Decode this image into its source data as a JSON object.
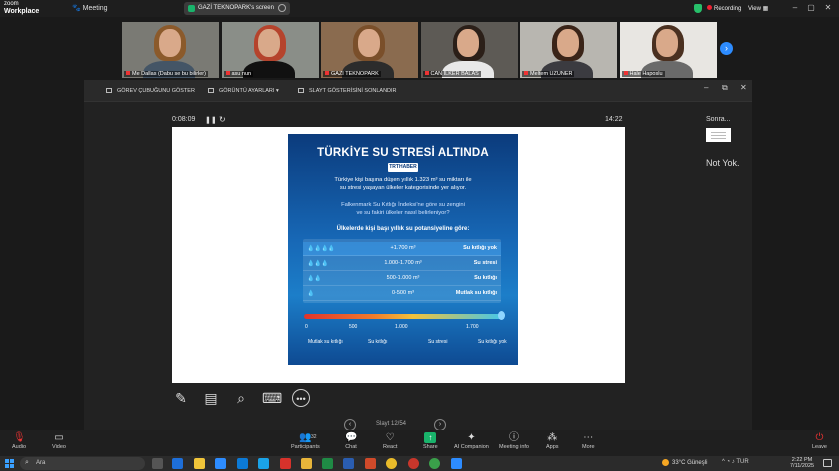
{
  "titlebar": {
    "app_name_line1": "zoom",
    "app_name_line2": "Workplace",
    "meeting_label": "Meeting",
    "tab_label": "GAZİ TEKNOPARK's screen",
    "recording_label": "Recording",
    "view_label": "View"
  },
  "gallery": {
    "participants": [
      {
        "name": "Me Dallas (Dabu se bu bilirler)",
        "hair": "#8b5a2b",
        "body": "#445566",
        "bg": "#7a7a74"
      },
      {
        "name": "asu nun",
        "hair": "#b5432c",
        "body": "#111111",
        "bg": "#8a8e88"
      },
      {
        "name": "GAZİ TEKNOPARK",
        "hair": "#7a4f2a",
        "body": "#2c2c2c",
        "bg": "#8a6b4f"
      },
      {
        "name": "CAN İLKER BALAS",
        "hair": "#2b1f18",
        "body": "#e8e8e8",
        "bg": "#5d5a55"
      },
      {
        "name": "Meltem UZUNER",
        "hair": "#3a2418",
        "body": "#3b3b40",
        "bg": "#b8b6b0"
      },
      {
        "name": "Hale Haposlu",
        "hair": "#4a3020",
        "body": "#6a6a6a",
        "bg": "#e8e6e2"
      }
    ],
    "next_icon": "chevron-right-icon"
  },
  "sharebar": {
    "taskbar_toggle": "GÖREV ÇUBUĞUNU GÖSTER",
    "display_settings": "GÖRÜNTÜ AYARLARI ▾",
    "end_slideshow": "SLAYT GÖSTERİSİNİ SONLANDIR"
  },
  "presenter": {
    "elapsed": "0:08:09",
    "clock": "14:22",
    "next_label": "Sonra...",
    "next_note": "Not Yok."
  },
  "infographic": {
    "title": "TÜRKİYE SU STRESİ ALTINDA",
    "brand": "TRTHABER",
    "p1_line1": "Türkiye kişi başına düşen yıllık 1.323 m³ su miktarı ile",
    "p1_line2": "su stresi yaşayan ülkeler kategorisinde yer alıyor.",
    "p2_line1": "Falkenmark Su Kıtlığı İndeksi'ne göre su zengini",
    "p2_line2": "ve su fakiri ülkeler nasıl belirleniyor?",
    "p3": "Ülkelerde kişi başı yıllık su potansiyeline göre:",
    "rows": [
      {
        "drops": "💧💧💧💧",
        "range": "+1.700 m³",
        "label": "Su kıtlığı yok"
      },
      {
        "drops": "💧💧💧",
        "range": "1.000-1.700 m³",
        "label": "Su stresi"
      },
      {
        "drops": "💧💧",
        "range": "500-1.000 m³",
        "label": "Su kıtlığı"
      },
      {
        "drops": "💧",
        "range": "0-500 m³",
        "label": "Mutlak su kıtlığı"
      }
    ],
    "ticks": [
      "0",
      "500",
      "1.000",
      "1.700"
    ],
    "categories": [
      "Mutlak su kıtlığı",
      "Su kıtlığı",
      "Su stresi",
      "Su kıtlığı yok"
    ]
  },
  "slide_tools": [
    "pen-icon",
    "slides-grid-icon",
    "zoom-icon",
    "screen-icon",
    "more-icon"
  ],
  "pager": {
    "text": "Slayt 12/54"
  },
  "zoombar": {
    "audio": "Audio",
    "video": "Video",
    "participants": "Participants",
    "participants_count": "32",
    "chat": "Chat",
    "react": "React",
    "share": "Share",
    "ai_companion": "AI Companion",
    "meeting_info": "Meeting info",
    "apps": "Apps",
    "more": "More",
    "leave": "Leave"
  },
  "taskbar": {
    "search_placeholder": "Ara",
    "weather": "33°C Güneşli",
    "lang": "TUR",
    "time": "2:22 PM",
    "date": "7/11/2025"
  },
  "colors": {
    "accent": "#2d8cff",
    "active_speaker": "#3ad16c",
    "share_green": "#19b36b",
    "record_red": "#e22233"
  }
}
